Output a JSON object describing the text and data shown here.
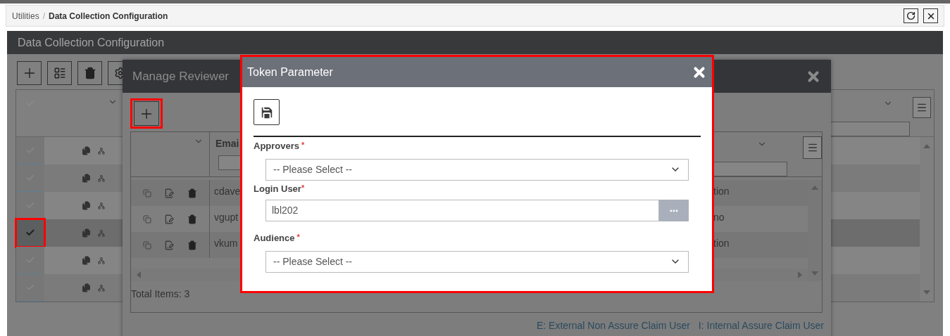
{
  "breadcrumb": {
    "separator": "/",
    "items": [
      {
        "label": "Utilities",
        "current": false
      },
      {
        "label": "Data Collection Configuration",
        "current": true
      }
    ]
  },
  "page": {
    "title": "Data Collection Configuration",
    "rows": [
      {
        "checked": false,
        "highlighted": false
      },
      {
        "checked": false,
        "highlighted": false
      },
      {
        "checked": false,
        "highlighted": false
      },
      {
        "checked": true,
        "highlighted": true
      },
      {
        "checked": false,
        "highlighted": false
      },
      {
        "checked": false,
        "highlighted": false
      }
    ]
  },
  "manage_reviewer": {
    "title": "Manage Reviewer",
    "add_highlighted": true,
    "columns": [
      {
        "label": "Emai"
      }
    ],
    "rows": [
      {
        "email": "cdave",
        "column_3": "tion"
      },
      {
        "email": "vgupt",
        "column_3": "no"
      },
      {
        "email": "vkum",
        "column_3": "tion"
      }
    ],
    "total": "Total Items: 3",
    "legend": [
      "E: External Non Assure Claim User",
      "I: Internal Assure Claim User"
    ]
  },
  "token_parameter": {
    "title": "Token Parameter",
    "highlighted": true,
    "fields": [
      {
        "kind": "select",
        "label": "Approvers",
        "required_mark": "*",
        "placeholder": "-- Please Select --"
      },
      {
        "kind": "lookup",
        "label": "Login User",
        "required_mark": "*",
        "value": "lbl202"
      },
      {
        "kind": "select",
        "label": "Audience",
        "required_mark": "*",
        "placeholder": "-- Please Select --"
      }
    ]
  }
}
